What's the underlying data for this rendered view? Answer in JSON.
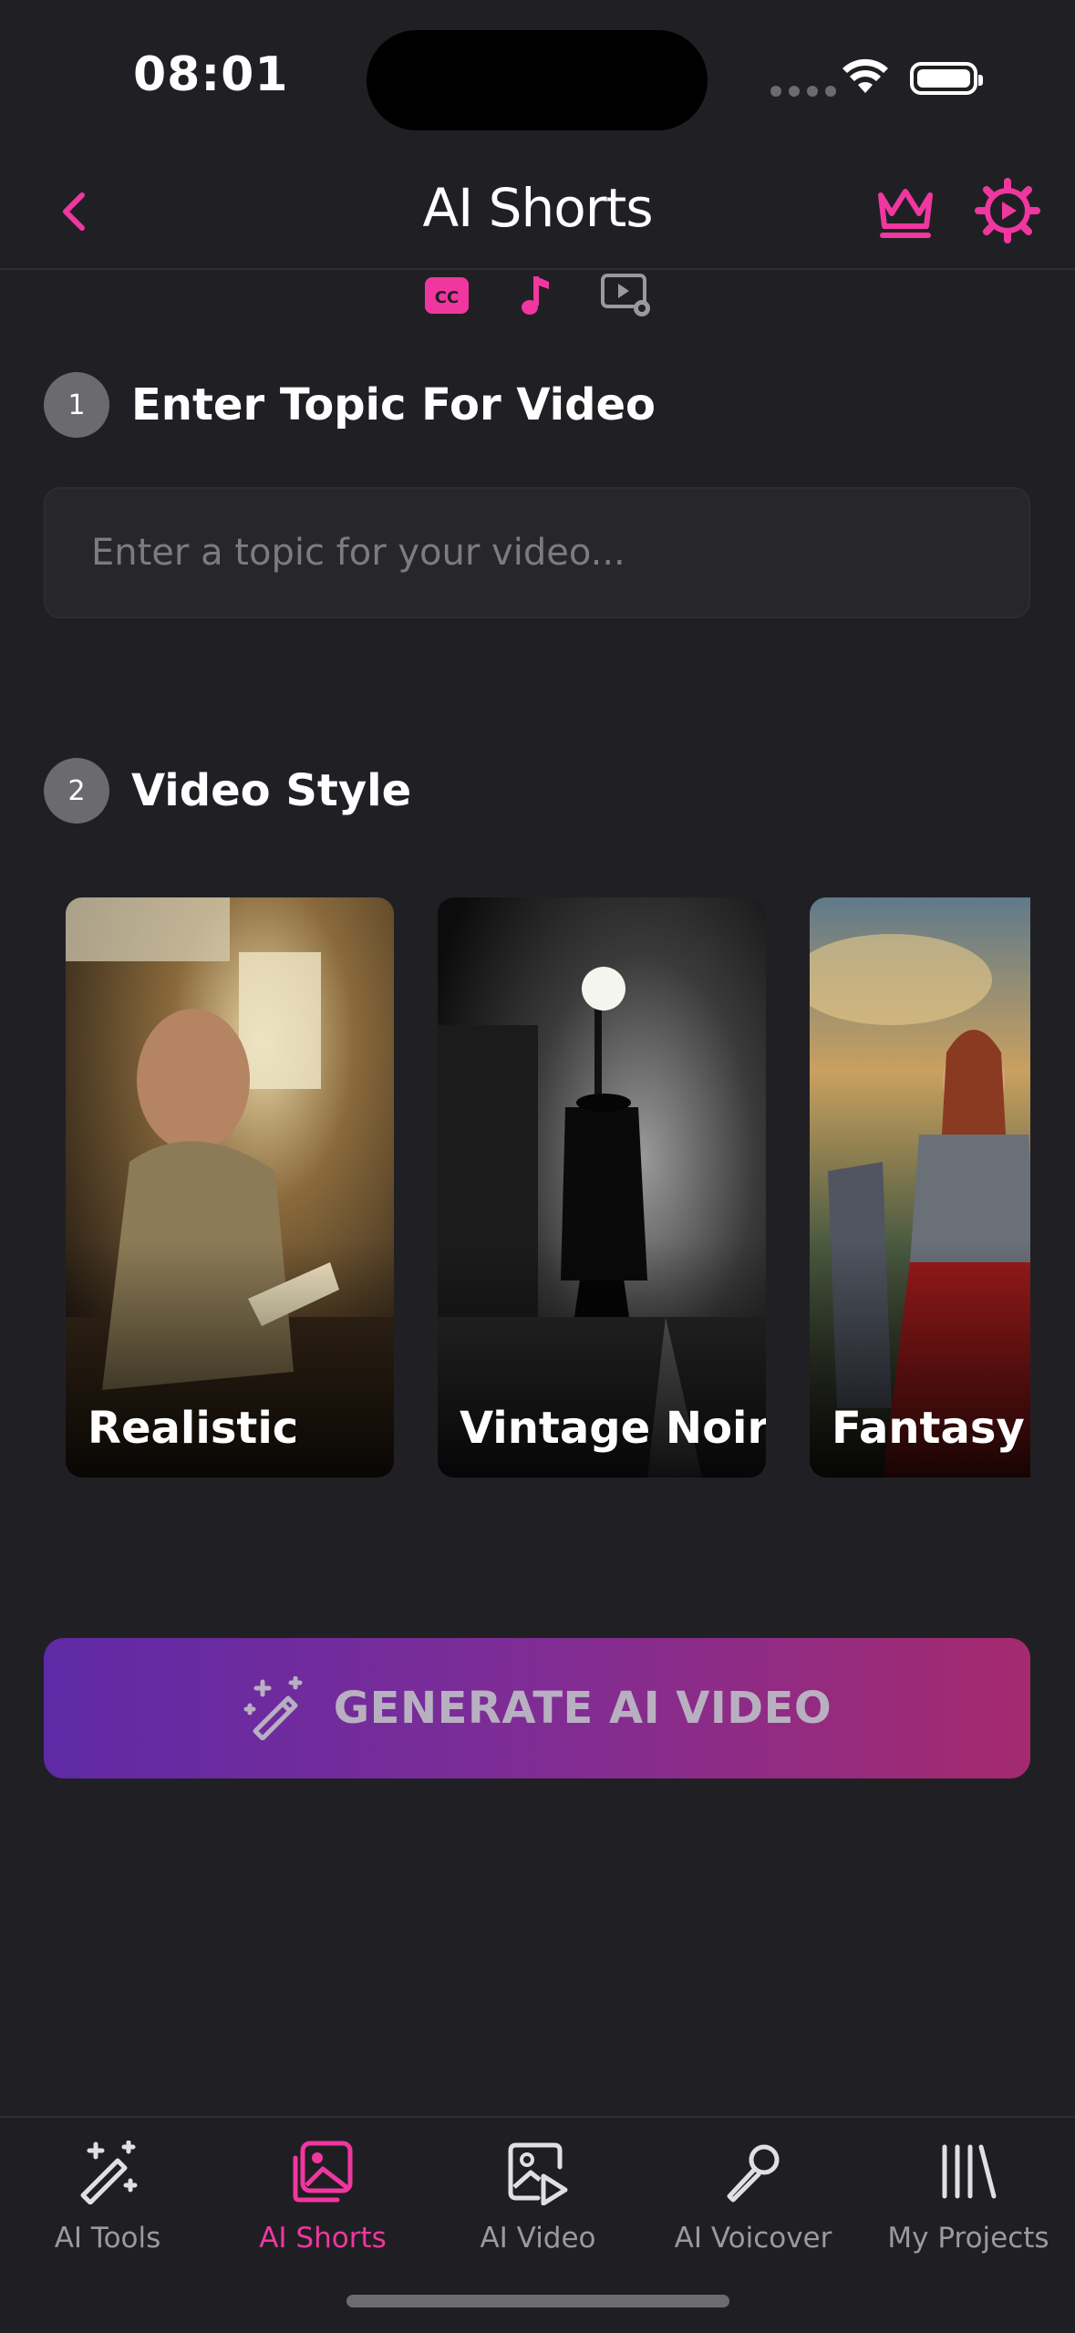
{
  "status_bar": {
    "time": "08:01"
  },
  "header": {
    "title": "AI Shorts"
  },
  "mini_tabs": [
    {
      "name": "captions",
      "icon": "cc-icon"
    },
    {
      "name": "music",
      "icon": "music-note-icon"
    },
    {
      "name": "video-settings",
      "icon": "video-settings-icon"
    }
  ],
  "step1": {
    "number": "1",
    "title": "Enter Topic For Video",
    "placeholder": "Enter a topic for your video..."
  },
  "step2": {
    "number": "2",
    "title": "Video Style"
  },
  "styles": [
    {
      "label": "Realistic"
    },
    {
      "label": "Vintage Noir"
    },
    {
      "label": "Fantasy"
    }
  ],
  "generate": {
    "label": "GENERATE AI VIDEO"
  },
  "tabs": [
    {
      "label": "AI Tools",
      "icon": "magic-wand-icon"
    },
    {
      "label": "AI Shorts",
      "icon": "shorts-gallery-icon",
      "active": true
    },
    {
      "label": "AI Video",
      "icon": "image-play-icon"
    },
    {
      "label": "AI Voicover",
      "icon": "microphone-icon"
    },
    {
      "label": "My Projects",
      "icon": "library-icon"
    }
  ],
  "colors": {
    "accent": "#f0379f",
    "background": "#202024",
    "gradient_start": "#5f2aa6",
    "gradient_end": "#a52a6f"
  }
}
